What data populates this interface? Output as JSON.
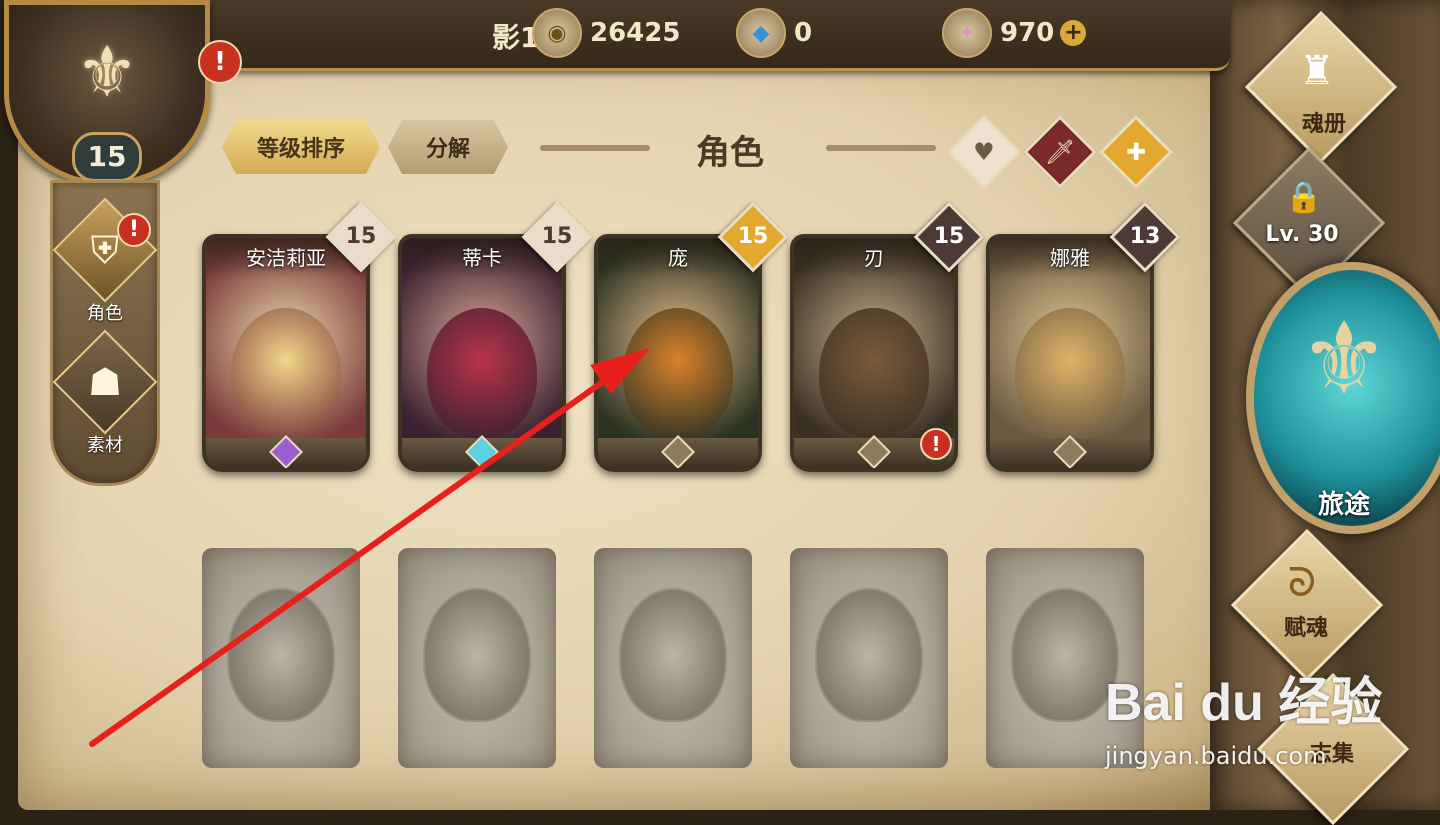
{
  "header": {
    "player_name": "影125",
    "gold": "26425",
    "crystal": "0",
    "gem": "970",
    "add_symbol": "+"
  },
  "profile": {
    "level": "15",
    "alert": "!"
  },
  "left_nav": [
    {
      "label": "角色",
      "icon": "helmet-icon",
      "alert": "!"
    },
    {
      "label": "素材",
      "icon": "beast-mask-icon"
    }
  ],
  "toolbar": {
    "sort_label": "等级排序",
    "decompose_label": "分解",
    "title": "角色"
  },
  "filters": [
    {
      "icon": "heart-icon",
      "symbol": "♥"
    },
    {
      "icon": "sword-icon",
      "symbol": "🗡"
    },
    {
      "icon": "shield-icon",
      "symbol": "✚"
    }
  ],
  "heroes": [
    {
      "name": "安洁莉亚",
      "level": "15",
      "badge_color": "#e7ddca",
      "level_text_color": "#4a3a26",
      "bg": "#7a3b3b",
      "face": "#f2d68a",
      "gem_color": "#9b5fd1"
    },
    {
      "name": "蒂卡",
      "level": "15",
      "badge_color": "#e7ddca",
      "level_text_color": "#4a3a26",
      "bg": "#3b2230",
      "face": "#b8334a",
      "gem_color": "#5ad0e0"
    },
    {
      "name": "庞",
      "level": "15",
      "badge_color": "#e3a92e",
      "level_text_color": "#ffffff",
      "bg": "#2d3324",
      "face": "#d9822b",
      "gem_color": "#8c7b5c"
    },
    {
      "name": "刃",
      "level": "15",
      "badge_color": "#4b3a36",
      "level_text_color": "#ffffff",
      "bg": "#3a3024",
      "face": "#7a5a3a",
      "gem_color": "#8c7b5c",
      "alert": "!"
    },
    {
      "name": "娜雅",
      "level": "13",
      "badge_color": "#4b3a36",
      "level_text_color": "#ffffff",
      "bg": "#6a5a40",
      "face": "#e1b36a",
      "gem_color": "#8c7b5c"
    }
  ],
  "locked_slots": 5,
  "right_menu": {
    "soul_book": "魂册",
    "locked_level": "Lv. 30",
    "journey": "旅途",
    "endow": "赋魂",
    "collection": "志集"
  },
  "watermark": {
    "main": "Bai du 经验",
    "sub": "jingyan.baidu.com"
  },
  "colors": {
    "accent_gold": "#d3ab55",
    "alert_red": "#c8301f",
    "arrow_red": "#e8201c"
  }
}
